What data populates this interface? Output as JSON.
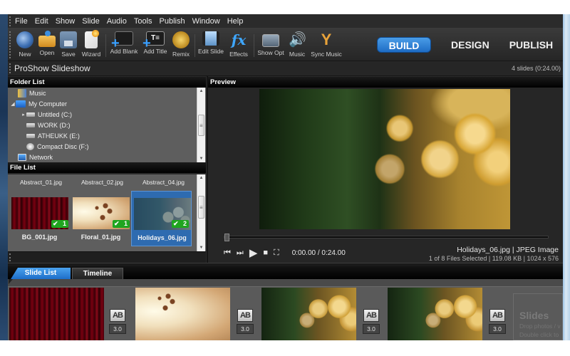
{
  "menu": [
    "File",
    "Edit",
    "Show",
    "Slide",
    "Audio",
    "Tools",
    "Publish",
    "Window",
    "Help"
  ],
  "toolbar": {
    "buttons": [
      {
        "label": "New",
        "icon": "new-show-icon"
      },
      {
        "label": "Open",
        "icon": "open-folder-icon"
      },
      {
        "label": "Save",
        "icon": "save-disk-icon"
      },
      {
        "label": "Wizard",
        "icon": "wizard-wand-icon"
      },
      {
        "label": "Add Blank",
        "icon": "add-blank-slide-icon"
      },
      {
        "label": "Add Title",
        "icon": "add-title-slide-icon"
      },
      {
        "label": "Remix",
        "icon": "remix-icon"
      },
      {
        "label": "Edit Slide",
        "icon": "edit-slide-filmstrip-icon"
      },
      {
        "label": "Effects",
        "icon": "effects-fx-icon"
      },
      {
        "label": "Show Opt",
        "icon": "show-options-icon"
      },
      {
        "label": "Music",
        "icon": "speaker-icon"
      },
      {
        "label": "Sync Music",
        "icon": "sync-music-icon"
      }
    ],
    "add_title_glyph": "T≡",
    "effects_glyph": "fx",
    "music_glyph": "🔊",
    "sync_glyph": "Y"
  },
  "modes": {
    "active": "BUILD",
    "others": [
      "DESIGN",
      "PUBLISH"
    ],
    "accent": "#1e6cc4"
  },
  "titlebar": {
    "app_title": "ProShow Slideshow",
    "slides_info": "4 slides (0:24.00)"
  },
  "folder_list": {
    "header": "Folder List",
    "items": [
      {
        "label": "Music",
        "icon": "music-folder-icon",
        "level": 1
      },
      {
        "label": "My Computer",
        "icon": "computer-icon",
        "level": 1,
        "expanded": true
      },
      {
        "label": "Untitled (C:)",
        "icon": "drive-icon",
        "level": 2,
        "has_children": true
      },
      {
        "label": "WORK (D:)",
        "icon": "drive-icon",
        "level": 2
      },
      {
        "label": "ATHEUKK (E:)",
        "icon": "drive-icon",
        "level": 2
      },
      {
        "label": "Compact Disc (F:)",
        "icon": "cd-drive-icon",
        "level": 2
      },
      {
        "label": "Network",
        "icon": "network-icon",
        "level": 1
      }
    ]
  },
  "file_list": {
    "header": "File List",
    "top_row": [
      "Abstract_01.jpg",
      "Abstract_02.jpg",
      "Abstract_04.jpg"
    ],
    "items": [
      {
        "name": "BG_001.jpg",
        "uses": "1",
        "selected": false
      },
      {
        "name": "Floral_01.jpg",
        "uses": "1",
        "selected": false
      },
      {
        "name": "Holidays_06.jpg",
        "uses": "2",
        "selected": true
      }
    ]
  },
  "preview": {
    "header": "Preview",
    "timecode": "0:00.00 / 0:24.00",
    "position_fraction": 0.0,
    "file_line": "Holidays_06.jpg  |  JPEG Image",
    "details_line": "1 of 8 Files Selected |  119.08 KB  |  1024 x 576",
    "controls": {
      "prev": "⏮",
      "next": "⏭",
      "play": "▶",
      "stop": "■",
      "fullscreen": "⛶"
    }
  },
  "slide_tabs": [
    "Slide List",
    "Timeline"
  ],
  "slides": [
    {
      "image": "BG_001.jpg",
      "transition_glyph": "AB",
      "duration": "3.0"
    },
    {
      "image": "Floral_01.jpg",
      "transition_glyph": "AB",
      "duration": "3.0"
    },
    {
      "image": "Holidays_06.jpg",
      "transition_glyph": "AB",
      "duration": "3.0"
    },
    {
      "image": "Holidays_06.jpg",
      "transition_glyph": "AB",
      "duration": "3.0"
    }
  ],
  "drop_zone": {
    "title": "Slides",
    "line1": "Drop photos / v",
    "line2": "Double click to"
  }
}
